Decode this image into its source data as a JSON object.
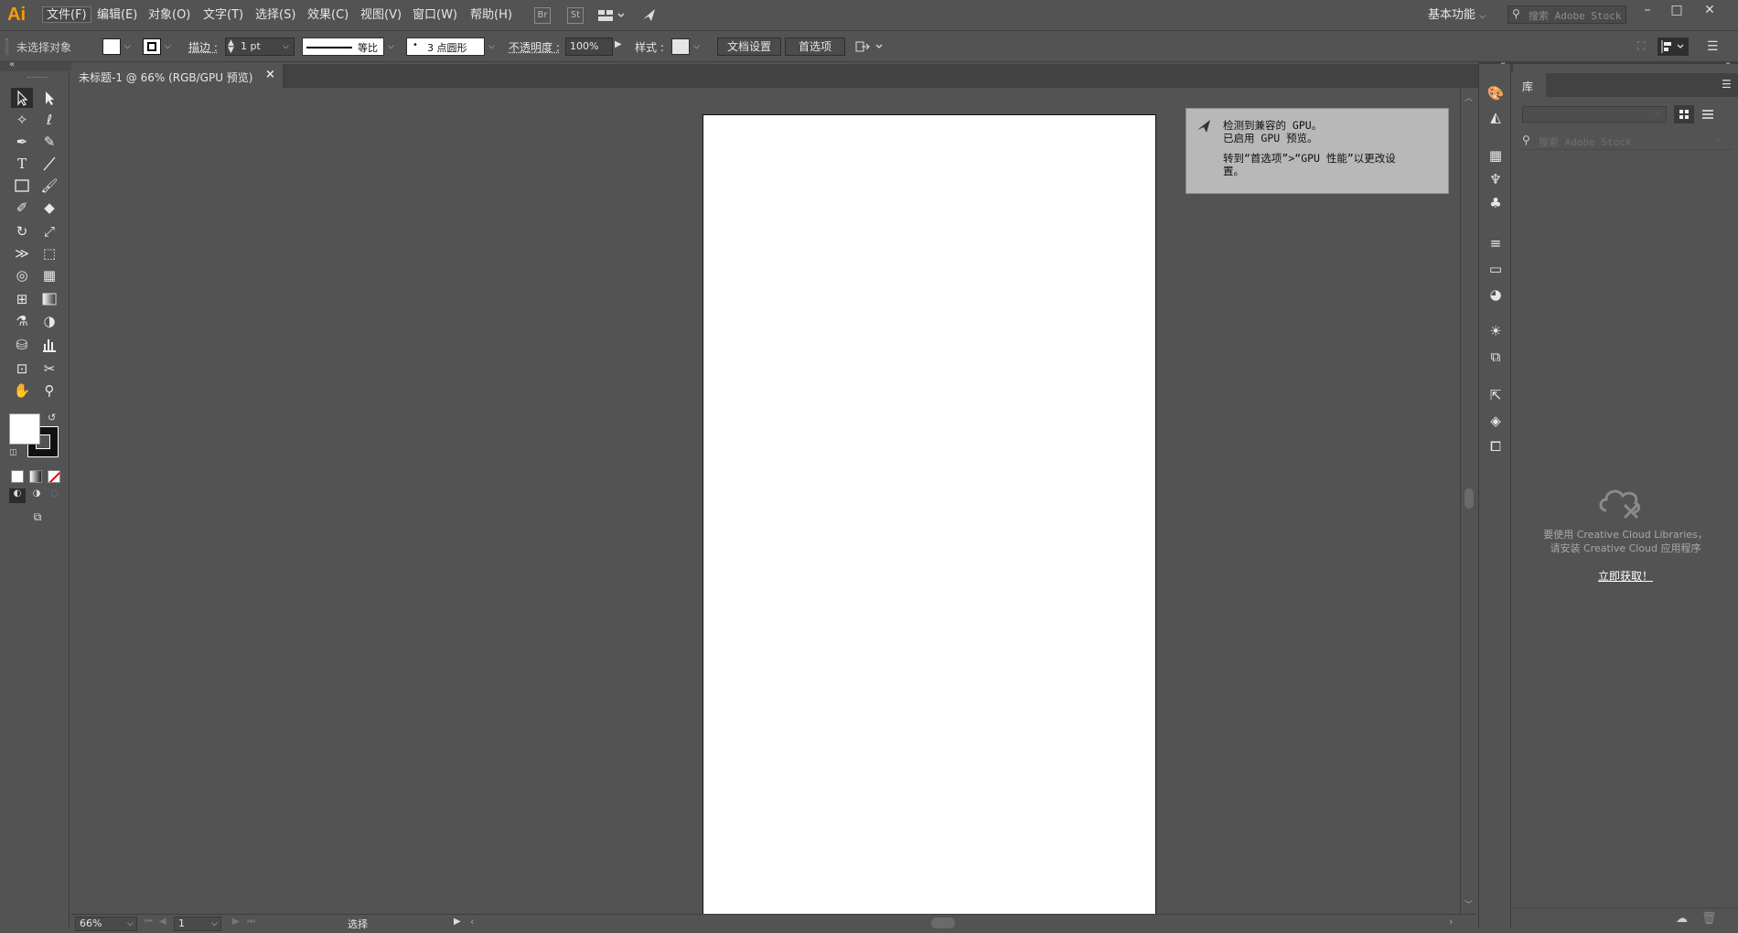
{
  "app": {
    "logo": "Ai"
  },
  "menu": [
    "文件(F)",
    "编辑(E)",
    "对象(O)",
    "文字(T)",
    "选择(S)",
    "效果(C)",
    "视图(V)",
    "窗口(W)",
    "帮助(H)"
  ],
  "menubar_badges": {
    "br": "Br",
    "st": "St"
  },
  "workspace": {
    "label": "基本功能"
  },
  "search": {
    "placeholder": "搜索 Adobe Stock"
  },
  "window_buttons": {
    "minimize": "–",
    "maximize": "□",
    "close": "✕"
  },
  "control": {
    "selection": "未选择对象",
    "stroke_label": "描边 :",
    "stroke_weight": "1 pt",
    "stroke_profile": "等比",
    "brush": "3 点圆形",
    "brush_dot": "•",
    "opacity_label": "不透明度 :",
    "opacity_value": "100%",
    "style_label": "样式 :",
    "doc_setup": "文档设置",
    "preferences": "首选项"
  },
  "document": {
    "tab_title": "未标题-1 @ 66% (RGB/GPU 预览)",
    "close": "×"
  },
  "notice": {
    "line1": "检测到兼容的 GPU。",
    "line2": "已启用 GPU 预览。",
    "line3": "转到“首选项”>“GPU 性能”以更改设",
    "line4": "置。"
  },
  "status": {
    "zoom": "66%",
    "artboard": "1",
    "tool": "选择"
  },
  "library": {
    "tab": "库",
    "search_placeholder": "搜索 Adobe Stock",
    "msg1": "要使用 Creative Cloud Libraries，",
    "msg2": "请安装 Creative Cloud 应用程序",
    "link": "立即获取！"
  },
  "colors": {
    "accent_logo": "#ff9a00",
    "ui_bg": "#535353",
    "artboard": "#ffffff",
    "notice_bg": "#b8b8b8"
  }
}
